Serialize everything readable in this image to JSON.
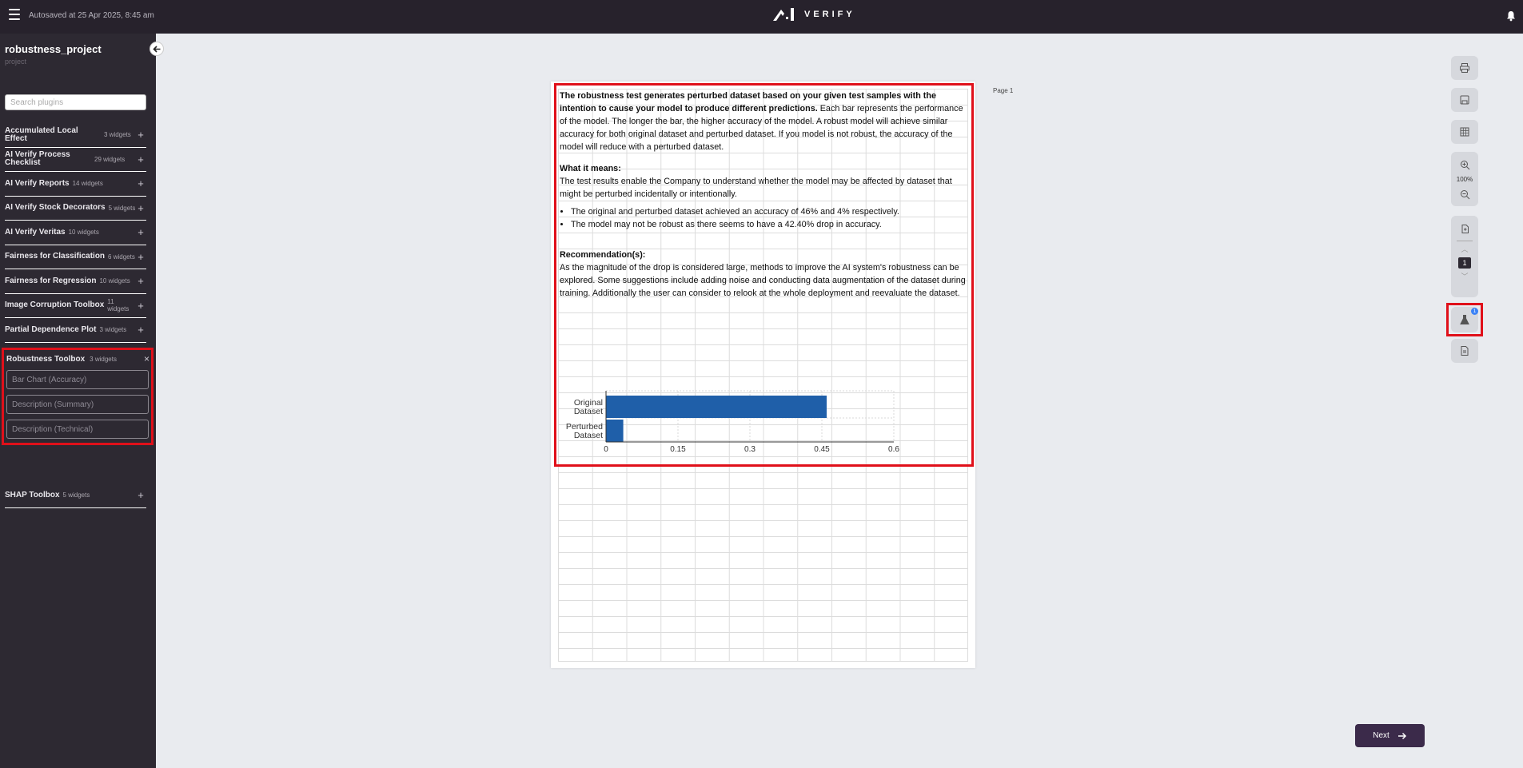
{
  "header": {
    "autosave_text": "Autosaved at 25 Apr 2025, 8:45 am",
    "logo_text": "VERIFY"
  },
  "sidebar": {
    "project_title": "robustness_project",
    "project_subtitle": "project",
    "search_placeholder": "Search plugins",
    "plugins": [
      {
        "name": "Accumulated Local Effect",
        "count": "3 widgets"
      },
      {
        "name": "AI Verify Process Checklist",
        "count": "29 widgets"
      },
      {
        "name": "AI Verify Reports",
        "count": "14 widgets"
      },
      {
        "name": "AI Verify Stock Decorators",
        "count": "5 widgets"
      },
      {
        "name": "AI Verify Veritas",
        "count": "10 widgets"
      },
      {
        "name": "Fairness for Classification",
        "count": "6 widgets"
      },
      {
        "name": "Fairness for Regression",
        "count": "10 widgets"
      },
      {
        "name": "Image Corruption Toolbox",
        "count": "11 widgets"
      },
      {
        "name": "Partial Dependence Plot",
        "count": "3 widgets"
      }
    ],
    "expanded_plugin": {
      "name": "Robustness Toolbox",
      "count": "3 widgets",
      "widgets": [
        "Bar Chart (Accuracy)",
        "Description (Summary)",
        "Description (Technical)"
      ]
    },
    "last_plugin": {
      "name": "SHAP Toolbox",
      "count": "5 widgets"
    }
  },
  "canvas": {
    "page_label": "Page 1",
    "report": {
      "intro_bold": "The robustness test generates perturbed dataset based on your given test samples with the intention to cause your model to produce different predictions.",
      "intro_rest": " Each bar represents the performance of the model. The longer the bar, the higher accuracy of the model. A robust model will achieve similar accuracy for both original dataset and perturbed dataset. If you model is not robust, the accuracy of the model will reduce with a perturbed dataset.",
      "what_heading": "What it means:",
      "what_text": "The test results enable the Company to understand whether the model may be affected by dataset that might be perturbed incidentally or intentionally.",
      "bullets": [
        "The original and perturbed dataset achieved an accuracy of 46% and 4% respectively.",
        "The model may not be robust as there seems to have a 42.40% drop in accuracy."
      ],
      "rec_heading": "Recommendation(s):",
      "rec_text": "As the magnitude of the drop is considered large, methods to improve the AI system's robustness can be explored. Some suggestions include adding noise and conducting data augmentation of the dataset during training. Additionally the user can consider to relook at the whole deployment and reevaluate the dataset."
    }
  },
  "toolbar": {
    "zoom_label": "100%",
    "page_number": "1",
    "badge_count": "1"
  },
  "footer": {
    "next_label": "Next"
  },
  "chart_data": {
    "type": "bar",
    "orientation": "horizontal",
    "categories": [
      "Original Dataset",
      "Perturbed Dataset"
    ],
    "category_lines": [
      [
        "Original",
        "Dataset"
      ],
      [
        "Perturbed",
        "Dataset"
      ]
    ],
    "values": [
      0.46,
      0.036
    ],
    "xlim": [
      0,
      0.6
    ],
    "xticks": [
      0,
      0.15,
      0.3,
      0.45,
      0.6
    ],
    "xtick_labels": [
      "0",
      "0.15",
      "0.3",
      "0.45",
      "0.6"
    ],
    "bar_color": "#1f5fa9",
    "grid": true
  }
}
